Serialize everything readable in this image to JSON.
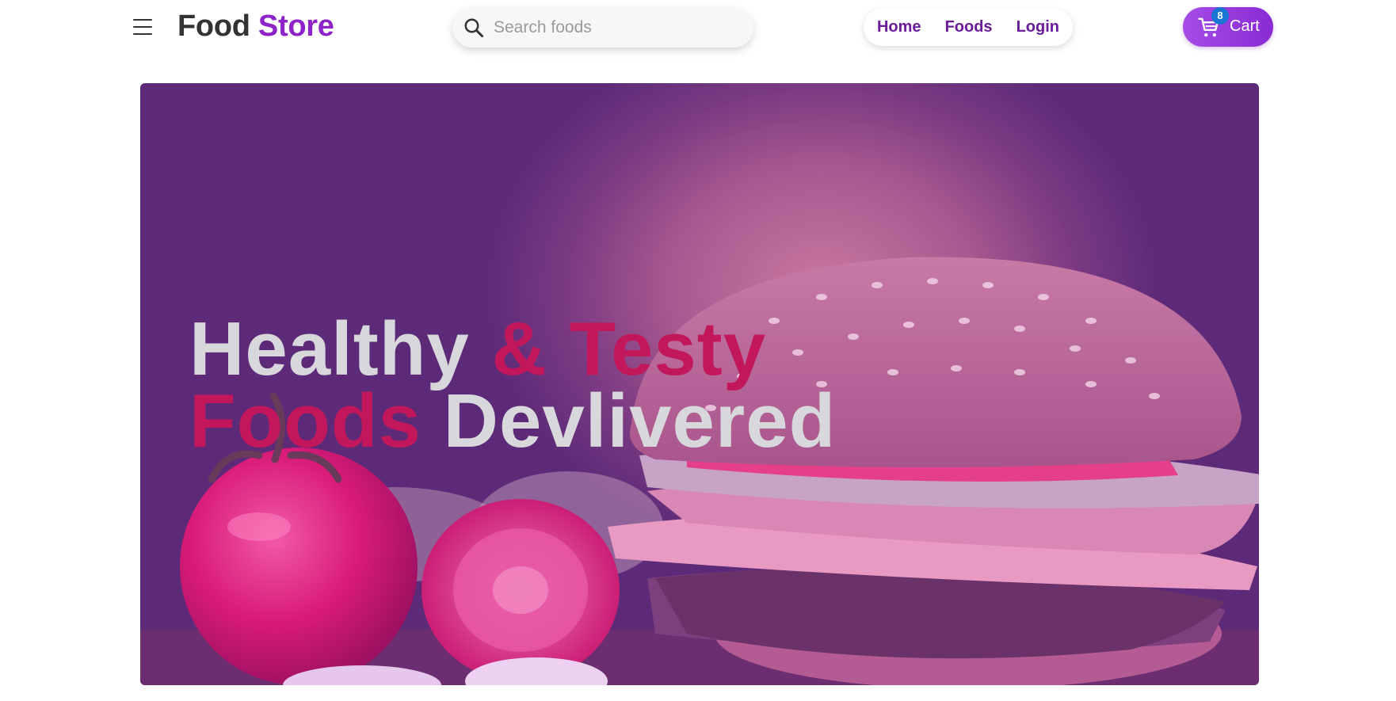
{
  "header": {
    "menu_icon": "hamburger-menu-icon",
    "logo": {
      "word1": "Food",
      "word2": "Store"
    },
    "search": {
      "placeholder": "Search foods",
      "icon": "search-icon"
    },
    "nav": {
      "home": "Home",
      "foods": "Foods",
      "login": "Login"
    },
    "cart": {
      "label": "Cart",
      "count": "8",
      "icon": "shopping-cart-icon"
    }
  },
  "hero": {
    "line1": {
      "part1": "Healthy",
      "part2": "& Testy"
    },
    "line2": {
      "part1": "Foods",
      "part2": "Devlivered"
    }
  },
  "colors": {
    "brand_purple": "#8e24c8",
    "nav_link": "#6a1b9a",
    "accent_pink": "#c2185b",
    "badge_blue": "#1976d2"
  }
}
